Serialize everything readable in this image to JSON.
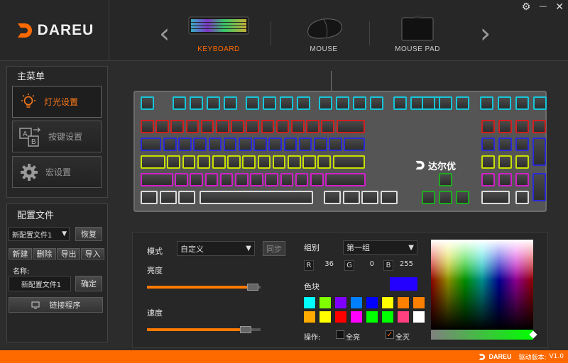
{
  "brand": {
    "logo_text": "DAREU"
  },
  "window_controls": {
    "settings": "⚙",
    "minimize": "—",
    "close": "✕"
  },
  "devices": [
    {
      "label": "KEYBOARD",
      "active": true
    },
    {
      "label": "MOUSE",
      "active": false
    },
    {
      "label": "MOUSE PAD",
      "active": false
    }
  ],
  "nav": {
    "prev": "‹",
    "next": "›"
  },
  "main_menu": {
    "title": "主菜单",
    "items": [
      {
        "label": "灯光设置",
        "icon": "lightbulb-icon",
        "active": true
      },
      {
        "label": "按键设置",
        "icon": "key-mapping-icon",
        "active": false
      },
      {
        "label": "宏设置",
        "icon": "gear-icon",
        "active": false
      }
    ]
  },
  "profile": {
    "title": "配置文件",
    "selected": "新配置文件1",
    "restore_label": "恢复",
    "new_label": "新建",
    "delete_label": "删除",
    "export_label": "导出",
    "import_label": "导入",
    "name_label": "名称:",
    "name_value": "新配置文件1",
    "confirm_label": "确定",
    "link_label": "链接程序"
  },
  "keyboard": {
    "badge_text": "达尔优"
  },
  "controls": {
    "mode_label": "模式",
    "mode_value": "自定义",
    "sync_label": "同步",
    "brightness_label": "亮度",
    "brightness_value": 0.93,
    "speed_label": "速度",
    "speed_value": 0.87,
    "group_label": "组别",
    "group_value": "第一组",
    "r_label": "R",
    "r_value": "36",
    "g_label": "G",
    "g_value": "0",
    "b_label": "B",
    "b_value": "255",
    "swatch_label": "色块",
    "current_color": "#2400ff",
    "operate_label": "操作:",
    "all_on_label": "全亮",
    "all_on_checked": false,
    "all_off_label": "全灭",
    "all_off_checked": true
  },
  "swatches": [
    "#00ffff",
    "#7fff00",
    "#8000ff",
    "#0080ff",
    "#0000ff",
    "#ffff00",
    "#ff8000",
    "#ff8000",
    "#ffaa00",
    "#ffff00",
    "#ff0000",
    "#ff00ff",
    "#00ff00",
    "#00ff00",
    "#ff4080",
    "#ffffff"
  ],
  "key_colors": {
    "cyan": "#16c4d8",
    "red": "#d02020",
    "blue": "#2a2ad8",
    "yellow": "#c8e000",
    "magenta": "#d020c8",
    "white": "#dcdcdc",
    "green": "#1faa1f"
  },
  "footer": {
    "brand": "DAREU",
    "version_label": "驱动版本:",
    "version": "V1.0"
  }
}
